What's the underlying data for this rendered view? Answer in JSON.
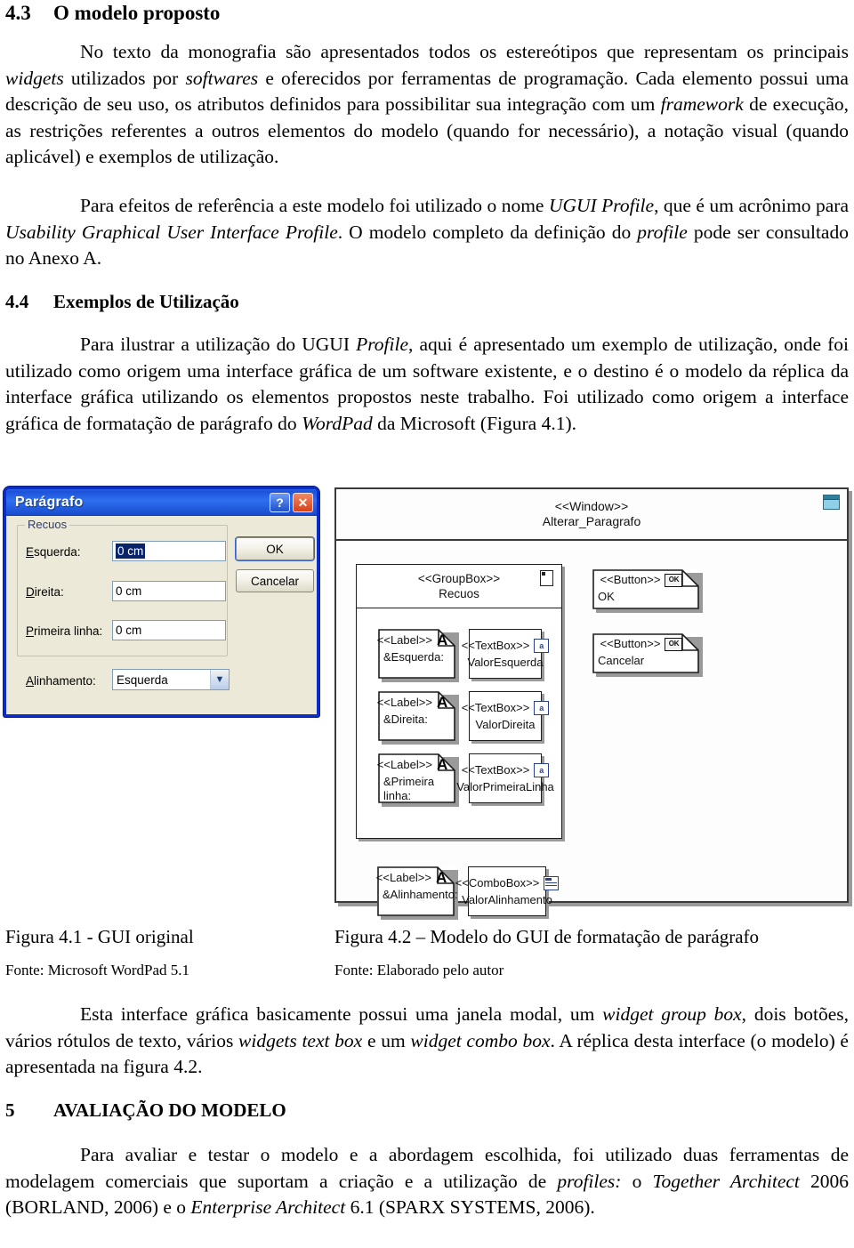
{
  "section_43": {
    "number": "4.3",
    "title": "O modelo proposto",
    "p1_a": "No texto da monografia são apresentados todos os estereótipos que representam os principais ",
    "p1_i1": "widgets",
    "p1_b": " utilizados por ",
    "p1_i2": "softwares",
    "p1_c": " e oferecidos por ferramentas de programação. Cada elemento possui uma descrição de seu uso, os atributos definidos para possibilitar sua integração com um ",
    "p1_i3": "framework",
    "p1_d": " de execução, as restrições referentes a outros elementos do modelo (quando for necessário), a notação visual (quando aplicável) e exemplos de utilização.",
    "p2_a": "Para efeitos de referência a este modelo foi utilizado o nome ",
    "p2_i1": "UGUI Profile",
    "p2_b": ", que é um acrônimo para ",
    "p2_i2": "Usability Graphical User Interface Profile",
    "p2_c": ". O modelo completo da definição do ",
    "p2_i3": "profile",
    "p2_d": " pode ser consultado no Anexo A."
  },
  "section_44": {
    "number": "4.4",
    "title": "Exemplos de Utilização",
    "p1_a": "Para ilustrar a utilização do UGUI ",
    "p1_i1": "Profile",
    "p1_b": ", aqui é apresentado um exemplo de utilização, onde foi utilizado como origem uma interface gráfica de um software existente, e o destino é o modelo da réplica da interface gráfica utilizando os elementos propostos neste trabalho. Foi utilizado como origem a interface gráfica de formatação de parágrafo do ",
    "p1_i2": "WordPad",
    "p1_c": " da Microsoft (Figura 4.1)."
  },
  "wordpad_dialog": {
    "title": "Parágrafo",
    "help_button": "?",
    "close_button": "✕",
    "group_legend": "Recuos",
    "fields": [
      {
        "label_underline": "E",
        "label_rest": "squerda:",
        "value": "0 cm",
        "selected": true
      },
      {
        "label_underline": "D",
        "label_rest": "ireita:",
        "value": "0 cm",
        "selected": false
      },
      {
        "label_underline": "P",
        "label_rest": "rimeira linha:",
        "value": "0 cm",
        "selected": false
      }
    ],
    "alignment": {
      "label_underline": "A",
      "label_rest": "linhamento:",
      "value": "Esquerda",
      "arrow": "▼"
    },
    "buttons": [
      {
        "label": "OK",
        "default": true
      },
      {
        "label": "Cancelar",
        "default": false
      }
    ]
  },
  "uml_model": {
    "window": {
      "stereotype": "<<Window>>",
      "name": "Alterar_Paragrafo",
      "icon": "window-icon"
    },
    "groupbox": {
      "stereotype": "<<GroupBox>>",
      "name": "Recuos",
      "icon": "groupbox-icon"
    },
    "rows": [
      {
        "label": {
          "stereotype": "<<Label>>",
          "name": "&Esquerda:",
          "icon": "label-A-icon"
        },
        "field": {
          "stereotype": "<<TextBox>>",
          "name": "ValorEsquerda",
          "icon": "textbox-icon"
        }
      },
      {
        "label": {
          "stereotype": "<<Label>>",
          "name": "&Direita:",
          "icon": "label-A-icon"
        },
        "field": {
          "stereotype": "<<TextBox>>",
          "name": "ValorDireita",
          "icon": "textbox-icon"
        }
      },
      {
        "label": {
          "stereotype": "<<Label>>",
          "name": "&Primeira linha:",
          "icon": "label-A-icon"
        },
        "field": {
          "stereotype": "<<TextBox>>",
          "name": "ValorPrimeiraLinha",
          "icon": "textbox-icon"
        }
      }
    ],
    "alignment_row": {
      "label": {
        "stereotype": "<<Label>>",
        "name": "&Alinhamento:",
        "icon": "label-A-icon"
      },
      "field": {
        "stereotype": "<<ComboBox>>",
        "name": "ValorAlinhamento",
        "icon": "combobox-icon"
      }
    },
    "buttons": [
      {
        "stereotype": "<<Button>>",
        "name": "OK",
        "icon": "ok-button-icon"
      },
      {
        "stereotype": "<<Button>>",
        "name": "Cancelar",
        "icon": "ok-button-icon"
      }
    ]
  },
  "captions": {
    "fig41": "Figura 4.1 - GUI original",
    "fig41_source": "Fonte: Microsoft WordPad 5.1",
    "fig42": "Figura 4.2 – Modelo do GUI de formatação de parágrafo",
    "fig42_source": "Fonte: Elaborado pelo autor"
  },
  "closing": {
    "p1_a": "Esta interface gráfica basicamente possui uma janela modal, um ",
    "p1_i1": "widget group box",
    "p1_b": ", dois botões, vários rótulos de texto, vários ",
    "p1_i2": "widgets text box",
    "p1_c": " e um ",
    "p1_i3": "widget combo box",
    "p1_d": ". A réplica desta interface (o modelo) é apresentada na figura 4.2."
  },
  "section_5": {
    "number": "5",
    "title": "AVALIAÇÃO DO MODELO",
    "p1_a": "Para avaliar e testar o modelo e a abordagem escolhida, foi utilizado duas ferramentas de modelagem comerciais que suportam a criação e a utilização de ",
    "p1_i1": "profiles:",
    "p1_b": " o ",
    "p1_i2": "Together Architect",
    "p1_c": " 2006 (BORLAND, 2006) e o ",
    "p1_i3": "Enterprise Architect",
    "p1_d": " 6.1 (SPARX SYSTEMS, 2006)."
  }
}
